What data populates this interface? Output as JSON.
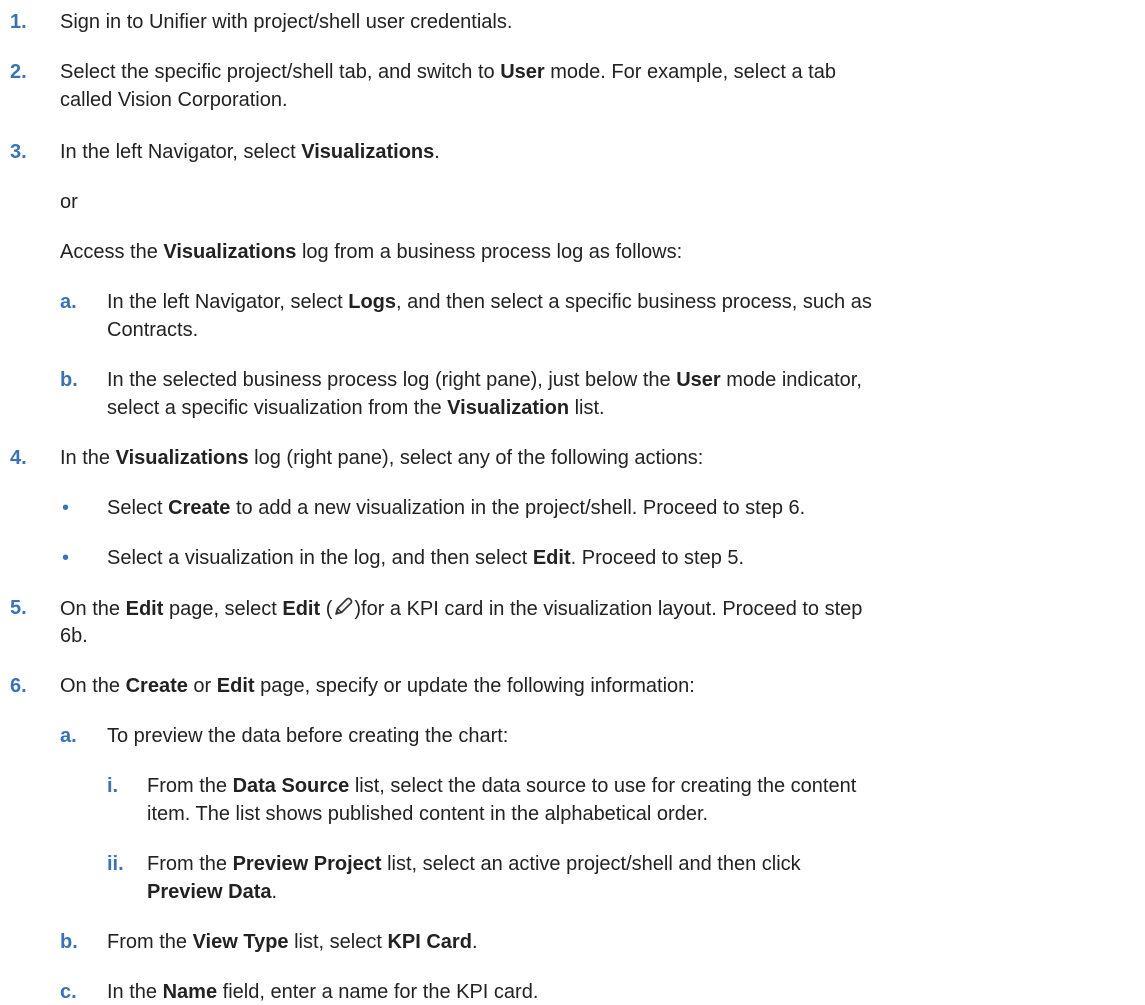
{
  "colors": {
    "step_number": "#3a72b5",
    "text": "#222222",
    "background": "#ffffff"
  },
  "icons": {
    "edit": "pencil-icon"
  },
  "s1": {
    "num": "1.",
    "t1": "Sign in to Unifier with project/shell user credentials."
  },
  "s2": {
    "num": "2.",
    "t1": "Select the specific project/shell tab, and switch to ",
    "b1": "User",
    "t2": " mode. For example, select a tab",
    "t3": "called Vision Corporation."
  },
  "s3": {
    "num": "3.",
    "t1": "In the left Navigator, select ",
    "b1": "Visualizations",
    "t2": ".",
    "or": "or",
    "t3": "Access the ",
    "b2": "Visualizations",
    "t4": " log from a business process log as follows:"
  },
  "s3a": {
    "num": "a.",
    "t1": "In the left Navigator, select ",
    "b1": "Logs",
    "t2": ", and then select a specific business process, such as",
    "t3": "Contracts."
  },
  "s3b": {
    "num": "b.",
    "t1": "In the selected business process log (right pane), just below the ",
    "b1": "User",
    "t2": " mode indicator,",
    "t3": "select a specific visualization from the ",
    "b2": "Visualization",
    "t4": " list."
  },
  "s4": {
    "num": "4.",
    "t1": "In the ",
    "b1": "Visualizations",
    "t2": " log (right pane), select any of the following actions:"
  },
  "s4x": {
    "bullet": "•",
    "t1": "Select ",
    "b1": "Create",
    "t2": " to add a new visualization in the project/shell. Proceed to step 6."
  },
  "s4y": {
    "bullet": "•",
    "t1": "Select a visualization in the log, and then select ",
    "b1": "Edit",
    "t2": ". Proceed to step 5."
  },
  "s5": {
    "num": "5.",
    "t1": "On the ",
    "b1": "Edit",
    "t2": " page, select ",
    "b2": "Edit",
    "t3": " (",
    "t4": ")for a KPI card in the visualization layout. Proceed to step",
    "t5": "6b."
  },
  "s6": {
    "num": "6.",
    "t1": "On the ",
    "b1": "Create",
    "t2": " or ",
    "b2": "Edit",
    "t3": " page, specify or update the following information:"
  },
  "s6a": {
    "num": "a.",
    "t1": "To preview the data before creating the chart:"
  },
  "s6ai": {
    "num": "i.",
    "t1": "From the ",
    "b1": "Data Source",
    "t2": " list, select the data source to use for creating the content",
    "t3": "item. The list shows published content in the alphabetical order."
  },
  "s6aii": {
    "num": "ii.",
    "t1": "From the ",
    "b1": "Preview Project",
    "t2": " list, select an active project/shell and then click",
    "b2": "Preview Data",
    "t3": "."
  },
  "s6b": {
    "num": "b.",
    "t1": "From the ",
    "b1": "View Type",
    "t2": " list, select ",
    "b2": "KPI Card",
    "t3": "."
  },
  "s6c": {
    "num": "c.",
    "t1": "In the ",
    "b1": "Name",
    "t2": " field, enter a name for the KPI card."
  }
}
